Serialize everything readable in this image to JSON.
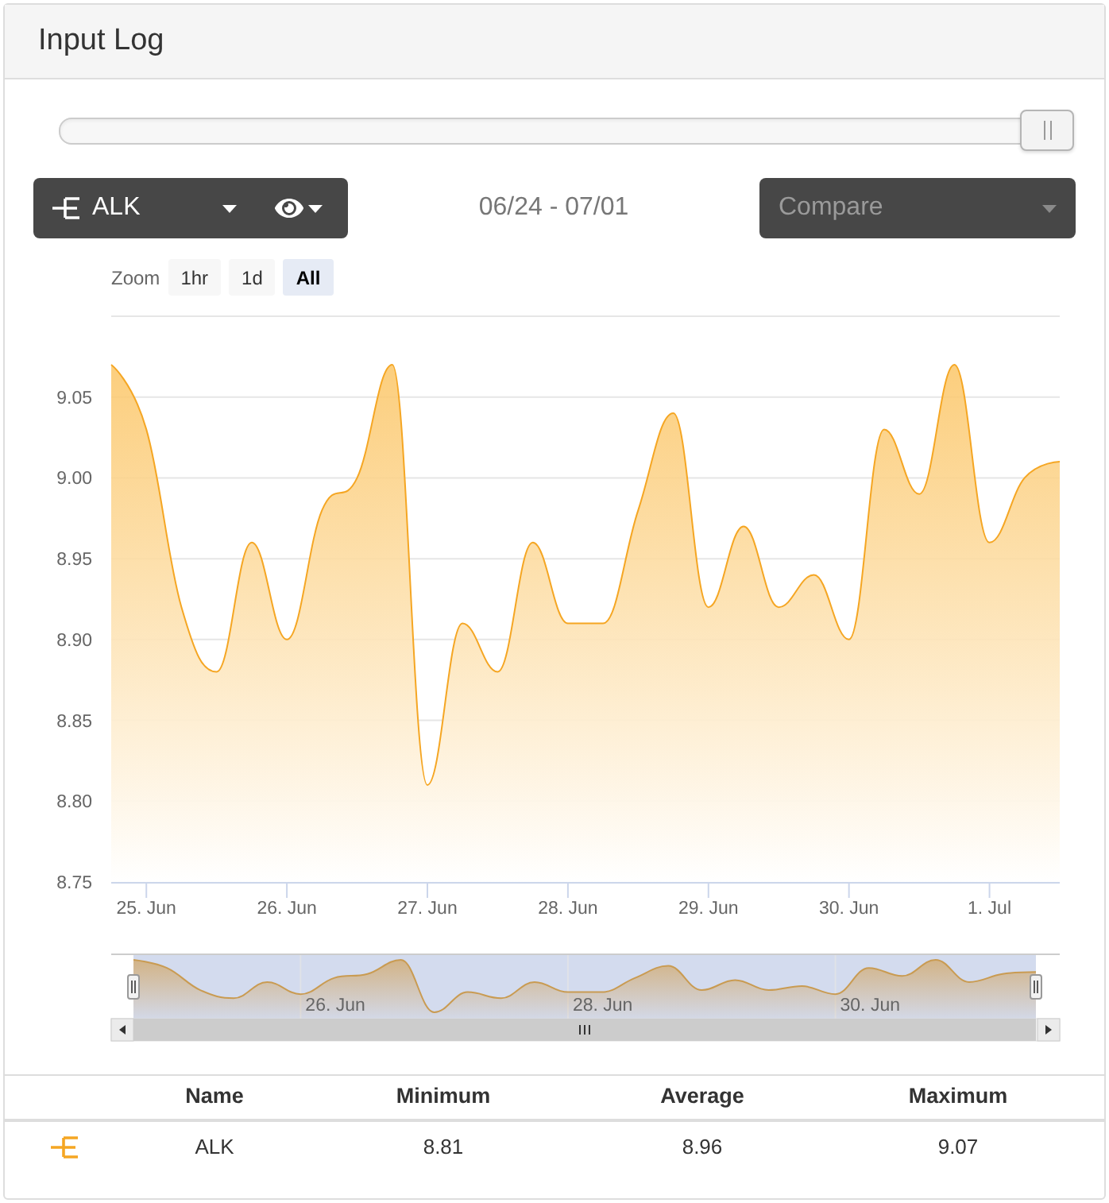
{
  "panel": {
    "title": "Input Log"
  },
  "range_slider": {
    "level": 1
  },
  "toolbar": {
    "parameter": {
      "label": "ALK"
    },
    "date_range": "06/24 - 07/01",
    "compare": {
      "placeholder": "Compare"
    }
  },
  "zoom": {
    "label": "Zoom",
    "buttons": [
      {
        "label": "1hr",
        "selected": false
      },
      {
        "label": "1d",
        "selected": false
      },
      {
        "label": "All",
        "selected": true
      }
    ]
  },
  "chart": {
    "chart_data": {
      "type": "area",
      "grid": true,
      "categories": [
        null,
        "25. Jun",
        null,
        null,
        null,
        "26. Jun",
        null,
        null,
        null,
        "27. Jun",
        null,
        null,
        null,
        "28. Jun",
        null,
        null,
        null,
        "29. Jun",
        null,
        null,
        null,
        "30. Jun",
        null,
        null,
        null,
        "1. Jul",
        null,
        null
      ],
      "series": [
        {
          "color": "#f5a623",
          "values": [
            9.07,
            9.03,
            8.92,
            8.88,
            8.96,
            8.9,
            8.98,
            9.0,
            9.07,
            8.81,
            8.91,
            8.88,
            8.96,
            8.91,
            8.91,
            8.98,
            9.04,
            8.92,
            8.97,
            8.92,
            8.94,
            8.9,
            9.03,
            8.99,
            9.07,
            8.96,
            9.0,
            9.01
          ]
        }
      ],
      "ylim": [
        8.75,
        9.1
      ],
      "yticks": [
        {
          "value": 8.75,
          "label": "8.75"
        },
        {
          "value": 8.8,
          "label": "8.80"
        },
        {
          "value": 8.85,
          "label": "8.85"
        },
        {
          "value": 8.9,
          "label": "8.90"
        },
        {
          "value": 8.95,
          "label": "8.95"
        },
        {
          "value": 9.0,
          "label": "9.00"
        },
        {
          "value": 9.05,
          "label": "9.05"
        }
      ]
    }
  },
  "navigator": {
    "labels": [
      "26. Jun",
      "28. Jun",
      "30. Jun"
    ]
  },
  "stats_table": {
    "columns": [
      "Name",
      "Minimum",
      "Average",
      "Maximum"
    ],
    "rows": [
      {
        "cells": [
          "ALK",
          "8.81",
          "8.96",
          "9.07"
        ]
      }
    ]
  }
}
